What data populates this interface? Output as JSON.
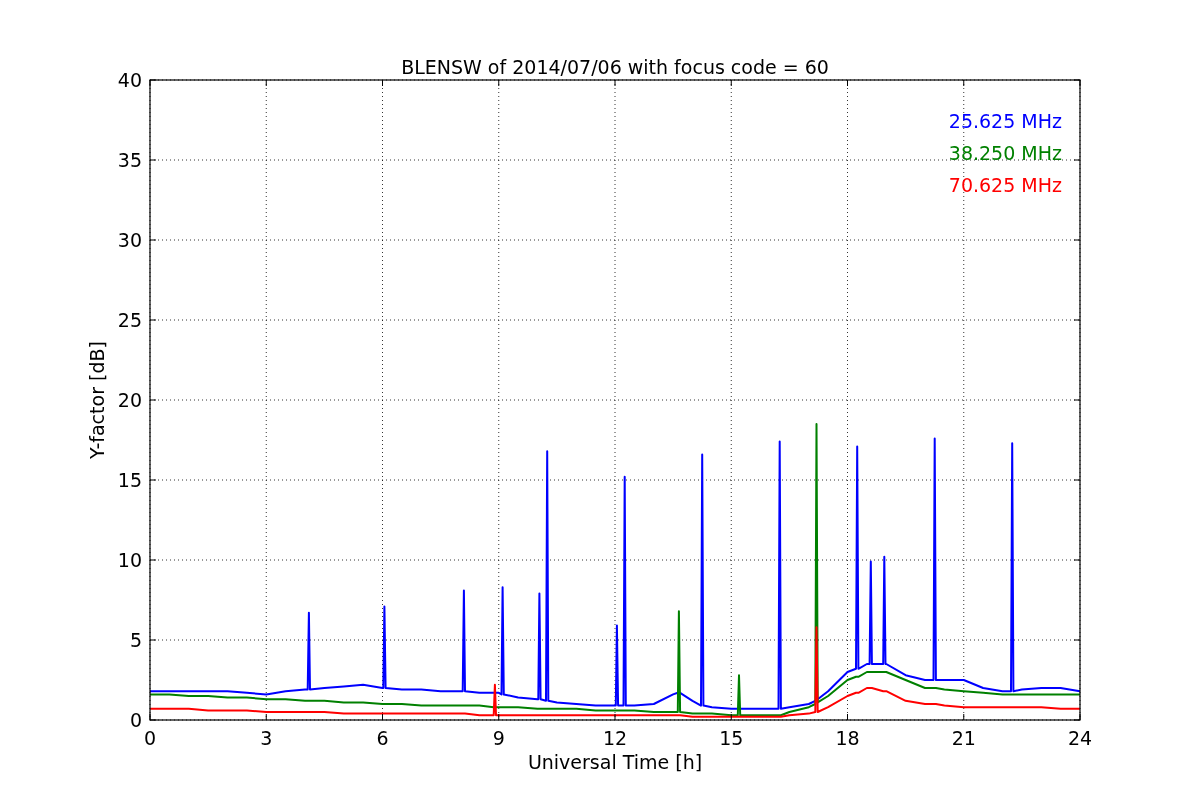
{
  "figure": {
    "chart_data": {
      "type": "line",
      "title": "BLENSW of 2014/07/06 with focus code = 60",
      "xlabel": "Universal Time [h]",
      "ylabel": "Y-factor [dB]",
      "grid": true,
      "xlim": [
        0,
        24
      ],
      "ylim": [
        0,
        40
      ],
      "xticks": [
        0,
        3,
        6,
        9,
        12,
        15,
        18,
        21,
        24
      ],
      "yticks": [
        0,
        5,
        10,
        15,
        20,
        25,
        30,
        35,
        40
      ],
      "x": [
        0,
        0.5,
        1,
        1.5,
        2,
        2.5,
        3,
        3.5,
        4,
        4.07,
        4.1,
        4.13,
        4.5,
        5,
        5.5,
        6,
        6.02,
        6.05,
        6.08,
        6.5,
        7,
        7.5,
        8,
        8.07,
        8.1,
        8.13,
        8.5,
        8.87,
        8.9,
        8.93,
        9,
        9.07,
        9.1,
        9.13,
        9.5,
        10,
        10.02,
        10.05,
        10.08,
        10.22,
        10.25,
        10.28,
        10.5,
        11,
        11.5,
        12,
        12.02,
        12.05,
        12.08,
        12.22,
        12.25,
        12.28,
        12.5,
        13,
        13.5,
        13.62,
        13.65,
        13.68,
        14,
        14.22,
        14.25,
        14.28,
        14.5,
        15,
        15.17,
        15.2,
        15.23,
        15.5,
        16,
        16.22,
        16.25,
        16.28,
        16.5,
        17,
        17.17,
        17.2,
        17.23,
        17.5,
        18,
        18.22,
        18.25,
        18.28,
        18.5,
        18.57,
        18.6,
        18.63,
        18.92,
        18.95,
        18.98,
        19,
        19.5,
        20,
        20.22,
        20.25,
        20.28,
        20.5,
        21,
        21.5,
        22,
        22.22,
        22.25,
        22.28,
        22.5,
        23,
        23.5,
        24
      ],
      "series": [
        {
          "name": "25.625 MHz",
          "color": "#0000ff",
          "values": [
            1.8,
            1.8,
            1.8,
            1.8,
            1.8,
            1.7,
            1.6,
            1.8,
            1.9,
            1.9,
            6.7,
            1.9,
            2.0,
            2.1,
            2.2,
            2.0,
            2.0,
            7.1,
            2.0,
            1.9,
            1.9,
            1.8,
            1.8,
            1.8,
            8.1,
            1.8,
            1.7,
            1.7,
            1.7,
            1.7,
            1.7,
            1.6,
            8.3,
            1.6,
            1.4,
            1.3,
            1.3,
            7.9,
            1.3,
            1.2,
            16.8,
            1.2,
            1.1,
            1.0,
            0.9,
            0.9,
            0.9,
            5.9,
            0.9,
            0.9,
            15.2,
            0.9,
            0.9,
            1.0,
            1.6,
            1.7,
            1.7,
            1.7,
            1.2,
            0.9,
            16.6,
            0.9,
            0.8,
            0.7,
            0.7,
            0.7,
            0.7,
            0.7,
            0.7,
            0.7,
            17.4,
            0.7,
            0.8,
            1.0,
            1.2,
            null,
            1.3,
            1.8,
            3.0,
            3.2,
            17.1,
            3.2,
            3.5,
            3.5,
            9.9,
            3.5,
            3.5,
            10.2,
            3.5,
            3.5,
            2.8,
            2.5,
            2.5,
            17.6,
            2.5,
            2.5,
            2.5,
            2.0,
            1.8,
            1.8,
            17.3,
            1.8,
            1.9,
            2.0,
            2.0,
            1.8
          ]
        },
        {
          "name": "38.250 MHz",
          "color": "#008000",
          "values": [
            1.6,
            1.6,
            1.5,
            1.5,
            1.4,
            1.4,
            1.3,
            1.3,
            1.2,
            1.2,
            1.2,
            1.2,
            1.2,
            1.1,
            1.1,
            1.0,
            1.0,
            1.0,
            1.0,
            1.0,
            0.9,
            0.9,
            0.9,
            0.9,
            0.9,
            0.9,
            0.9,
            0.8,
            0.8,
            0.8,
            0.8,
            0.8,
            0.8,
            0.8,
            0.8,
            0.7,
            0.7,
            0.7,
            0.7,
            0.7,
            0.7,
            0.7,
            0.7,
            0.7,
            0.6,
            0.6,
            0.6,
            0.6,
            0.6,
            0.6,
            0.6,
            0.6,
            0.6,
            0.5,
            0.5,
            0.5,
            6.8,
            0.5,
            0.4,
            0.4,
            0.4,
            0.4,
            0.4,
            0.3,
            0.3,
            2.8,
            0.3,
            0.3,
            0.3,
            0.3,
            0.3,
            0.3,
            0.5,
            0.8,
            1.0,
            18.5,
            1.1,
            1.5,
            2.5,
            2.7,
            2.7,
            2.7,
            3.0,
            3.0,
            3.0,
            3.0,
            3.0,
            3.0,
            3.0,
            3.0,
            2.5,
            2.0,
            2.0,
            2.0,
            2.0,
            1.9,
            1.8,
            1.7,
            1.6,
            1.6,
            1.6,
            1.6,
            1.6,
            1.6,
            1.6,
            1.6
          ]
        },
        {
          "name": "70.625 MHz",
          "color": "#ff0000",
          "values": [
            0.7,
            0.7,
            0.7,
            0.6,
            0.6,
            0.6,
            0.5,
            0.5,
            0.5,
            0.5,
            0.5,
            0.5,
            0.5,
            0.4,
            0.4,
            0.4,
            0.4,
            0.4,
            0.4,
            0.4,
            0.4,
            0.4,
            0.4,
            0.4,
            0.4,
            0.4,
            0.3,
            0.3,
            2.2,
            0.3,
            0.3,
            0.3,
            0.3,
            0.3,
            0.3,
            0.3,
            0.3,
            0.3,
            0.3,
            0.3,
            0.3,
            0.3,
            0.3,
            0.3,
            0.3,
            0.3,
            0.3,
            0.3,
            0.3,
            0.3,
            0.3,
            0.3,
            0.3,
            0.3,
            0.3,
            0.3,
            0.3,
            0.3,
            0.2,
            0.2,
            0.2,
            0.2,
            0.2,
            0.2,
            0.2,
            0.2,
            0.2,
            0.2,
            0.2,
            0.2,
            0.2,
            0.2,
            0.3,
            0.4,
            0.5,
            5.8,
            0.5,
            0.8,
            1.5,
            1.7,
            1.7,
            1.7,
            2.0,
            2.0,
            2.0,
            2.0,
            1.8,
            1.8,
            1.8,
            1.8,
            1.2,
            1.0,
            1.0,
            1.0,
            1.0,
            0.9,
            0.8,
            0.8,
            0.8,
            0.8,
            0.8,
            0.8,
            0.8,
            0.8,
            0.7,
            0.7
          ]
        }
      ]
    }
  }
}
